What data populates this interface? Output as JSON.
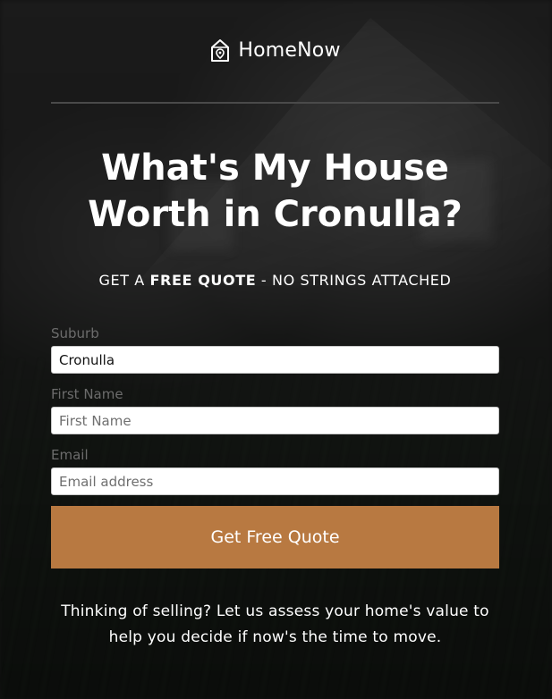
{
  "brand": {
    "name": "HomeNow",
    "icon": "house-pin-icon"
  },
  "headline": {
    "line1": "What's My House",
    "line2": "Worth in Cronulla?"
  },
  "subheadline": {
    "prefix": "GET A ",
    "emphasis": "FREE QUOTE",
    "suffix": " - NO STRINGS ATTACHED"
  },
  "form": {
    "suburb": {
      "label": "Suburb",
      "value": "Cronulla",
      "placeholder": "Suburb"
    },
    "first_name": {
      "label": "First Name",
      "value": "",
      "placeholder": "First Name"
    },
    "email": {
      "label": "Email",
      "value": "",
      "placeholder": "Email address"
    },
    "submit_label": "Get Free Quote"
  },
  "footer": {
    "text": "Thinking of selling? Let us assess your home's value to help you decide if now's the time to move."
  },
  "colors": {
    "accent": "#b87941",
    "background": "#121212",
    "label": "#6c6c6c",
    "divider": "#4a4a4a"
  }
}
